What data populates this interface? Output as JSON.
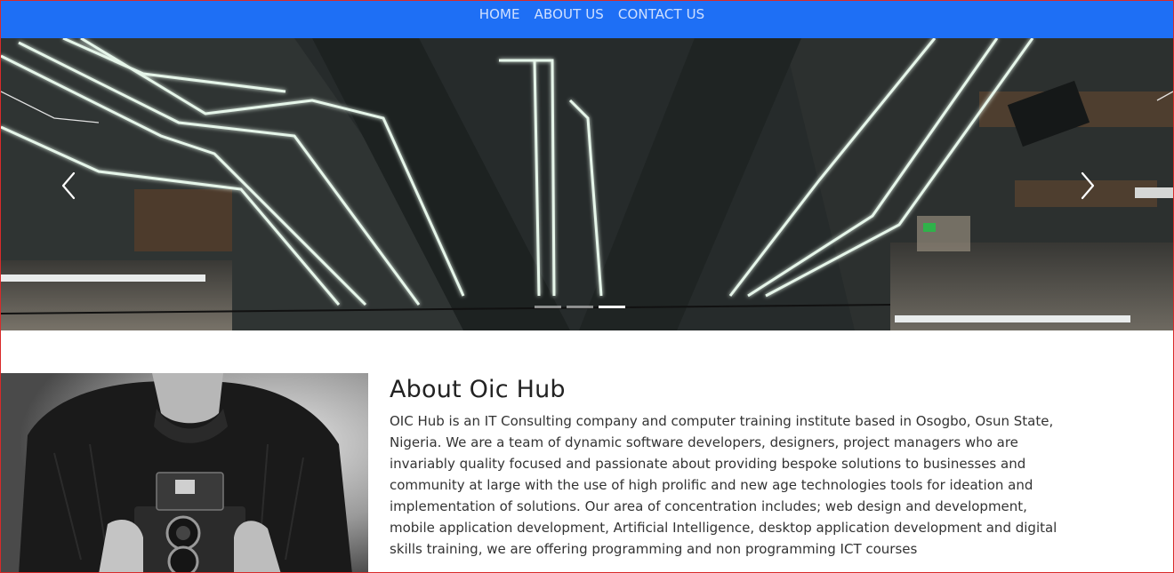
{
  "nav": {
    "items": [
      {
        "label": "HOME"
      },
      {
        "label": "ABOUT US"
      },
      {
        "label": "CONTACT US"
      }
    ],
    "background": "#1e6ff5"
  },
  "carousel": {
    "slide_count": 3,
    "active_index": 2,
    "prev_icon": "chevron-left-icon",
    "next_icon": "chevron-right-icon"
  },
  "about": {
    "title": "About Oic Hub",
    "body": "OIC Hub is an IT Consulting company and computer training institute based in Osogbo, Osun State, Nigeria. We are a team of dynamic software developers, designers, project managers who are invariably quality focused and passionate about providing bespoke solutions to businesses and community at large with the use of high prolific and new age technologies tools for ideation and implementation of solutions. Our area of concentration includes; web design and development, mobile application development, Artificial Intelligence, desktop application development and digital skills training, we are offering programming and non programming ICT courses"
  }
}
